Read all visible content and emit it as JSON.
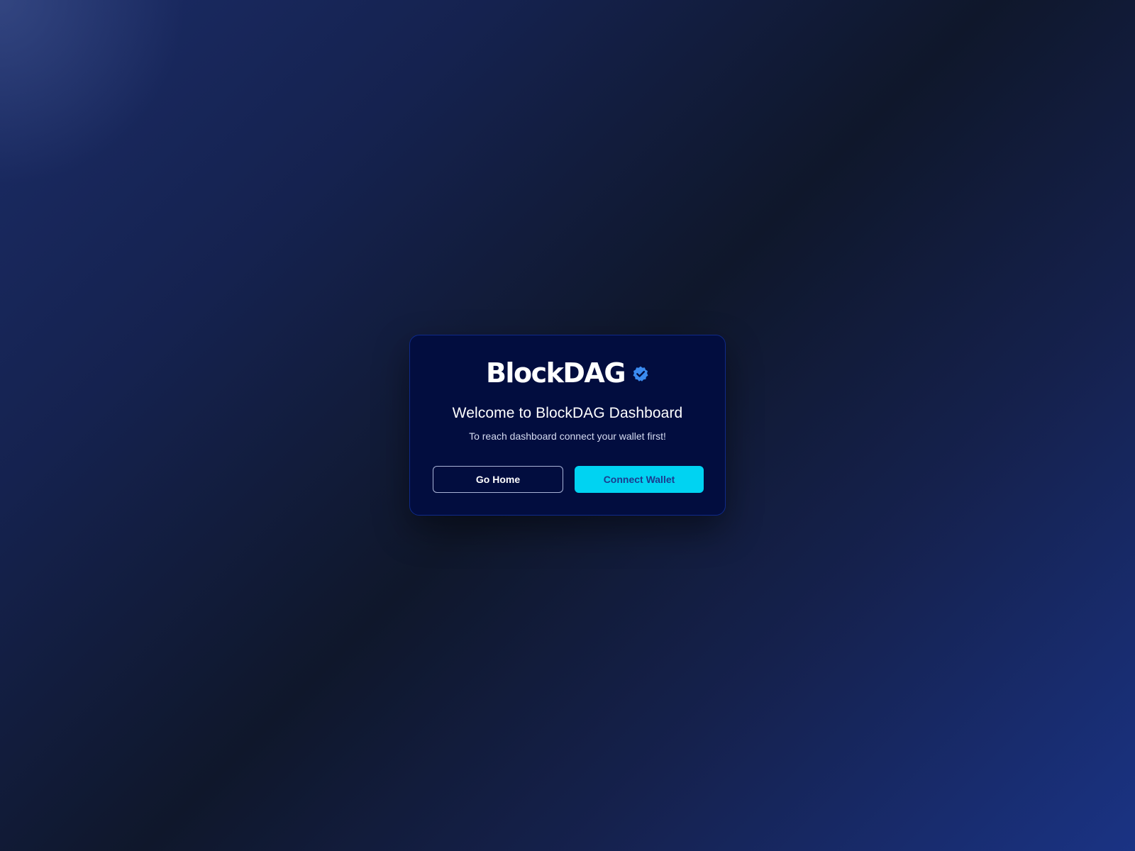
{
  "brand": {
    "name": "BlockDAG",
    "verified_icon": "verified-badge-icon",
    "badge_color": "#3b8bf0"
  },
  "modal": {
    "title": "Welcome to BlockDAG Dashboard",
    "subtitle": "To reach dashboard connect your wallet first!",
    "go_home_label": "Go Home",
    "connect_wallet_label": "Connect Wallet"
  },
  "colors": {
    "accent": "#00d3f2",
    "modal_background": "#020d3f",
    "modal_border": "#0f2a8a"
  }
}
